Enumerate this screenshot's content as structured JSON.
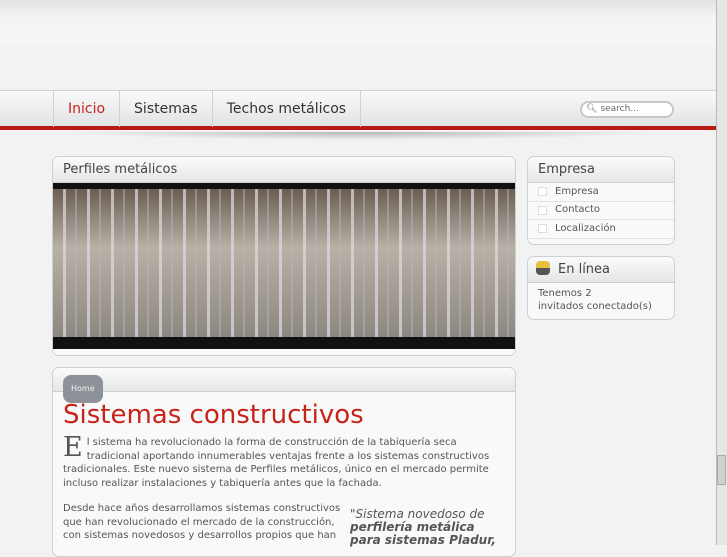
{
  "nav": {
    "items": [
      "Inicio",
      "Sistemas",
      "Techos metálicos"
    ],
    "search_placeholder": "search..."
  },
  "slideshow": {
    "title": "Perfiles metálicos"
  },
  "breadcrumb": "Home",
  "article": {
    "title": "Sistemas constructivos",
    "drop_cap": "E",
    "p1": "l sistema  ha revolucionado la forma de construcción de la tabiquería seca tradicional aportando innumerables ventajas frente a los sistemas constructivos tradicionales. Este nuevo sistema de Perfiles metálicos, único en el mercado permite incluso realizar instalaciones y tabiquería antes que la fachada.",
    "p2": "Desde hace años desarrollamos sistemas constructivos que han revolucionado el mercado de la construcción, con sistemas novedosos y desarrollos propios que han",
    "quote_light": "\"Sistema novedoso de",
    "quote_bold": "perfilería metálica para sistemas Pladur,"
  },
  "sidebar": {
    "menu_title": "Empresa",
    "menu": [
      "Empresa",
      "Contacto",
      "Localización"
    ],
    "online_title": "En línea",
    "online_line1": "Tenemos 2",
    "online_line2": "invitados conectado(s)"
  }
}
